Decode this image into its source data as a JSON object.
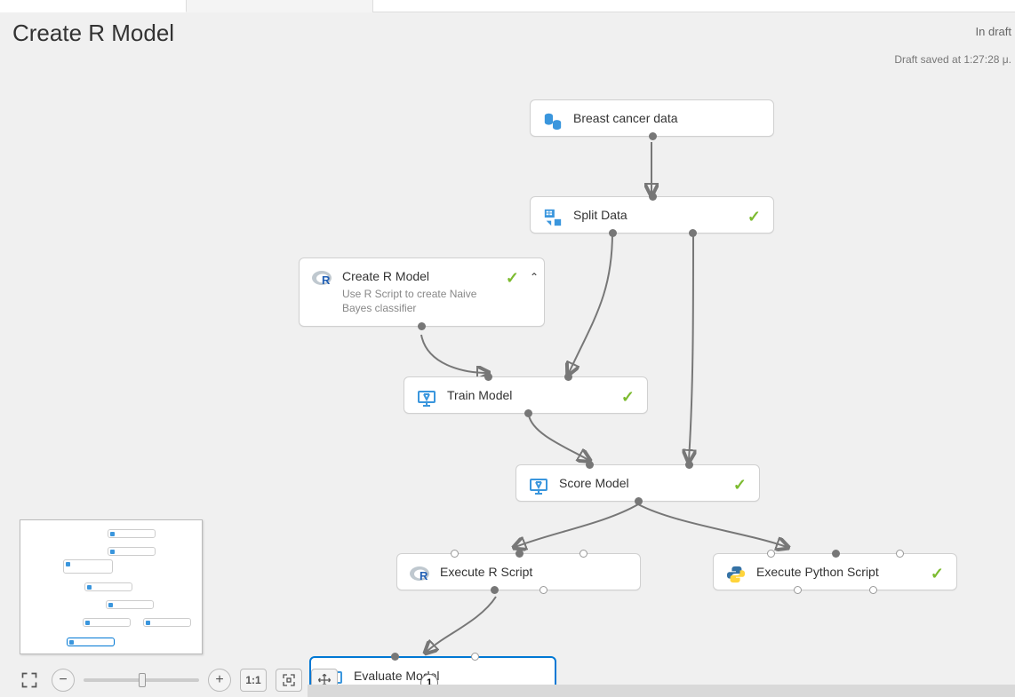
{
  "header": {
    "title": "Create R Model",
    "status": "In draft",
    "saved_line": "Draft saved at 1:27:28 μ."
  },
  "nodes": {
    "data": {
      "label": "Breast cancer data"
    },
    "split": {
      "label": "Split Data"
    },
    "crm": {
      "label": "Create R Model",
      "desc": "Use R Script to create Naive Bayes classifier"
    },
    "train": {
      "label": "Train Model"
    },
    "score": {
      "label": "Score Model"
    },
    "execr": {
      "label": "Execute R Script"
    },
    "execpy": {
      "label": "Execute Python Script"
    },
    "eval": {
      "label": "Evaluate Model"
    }
  },
  "toolbar": {
    "zoom_11": "1:1",
    "page_number": "1"
  }
}
